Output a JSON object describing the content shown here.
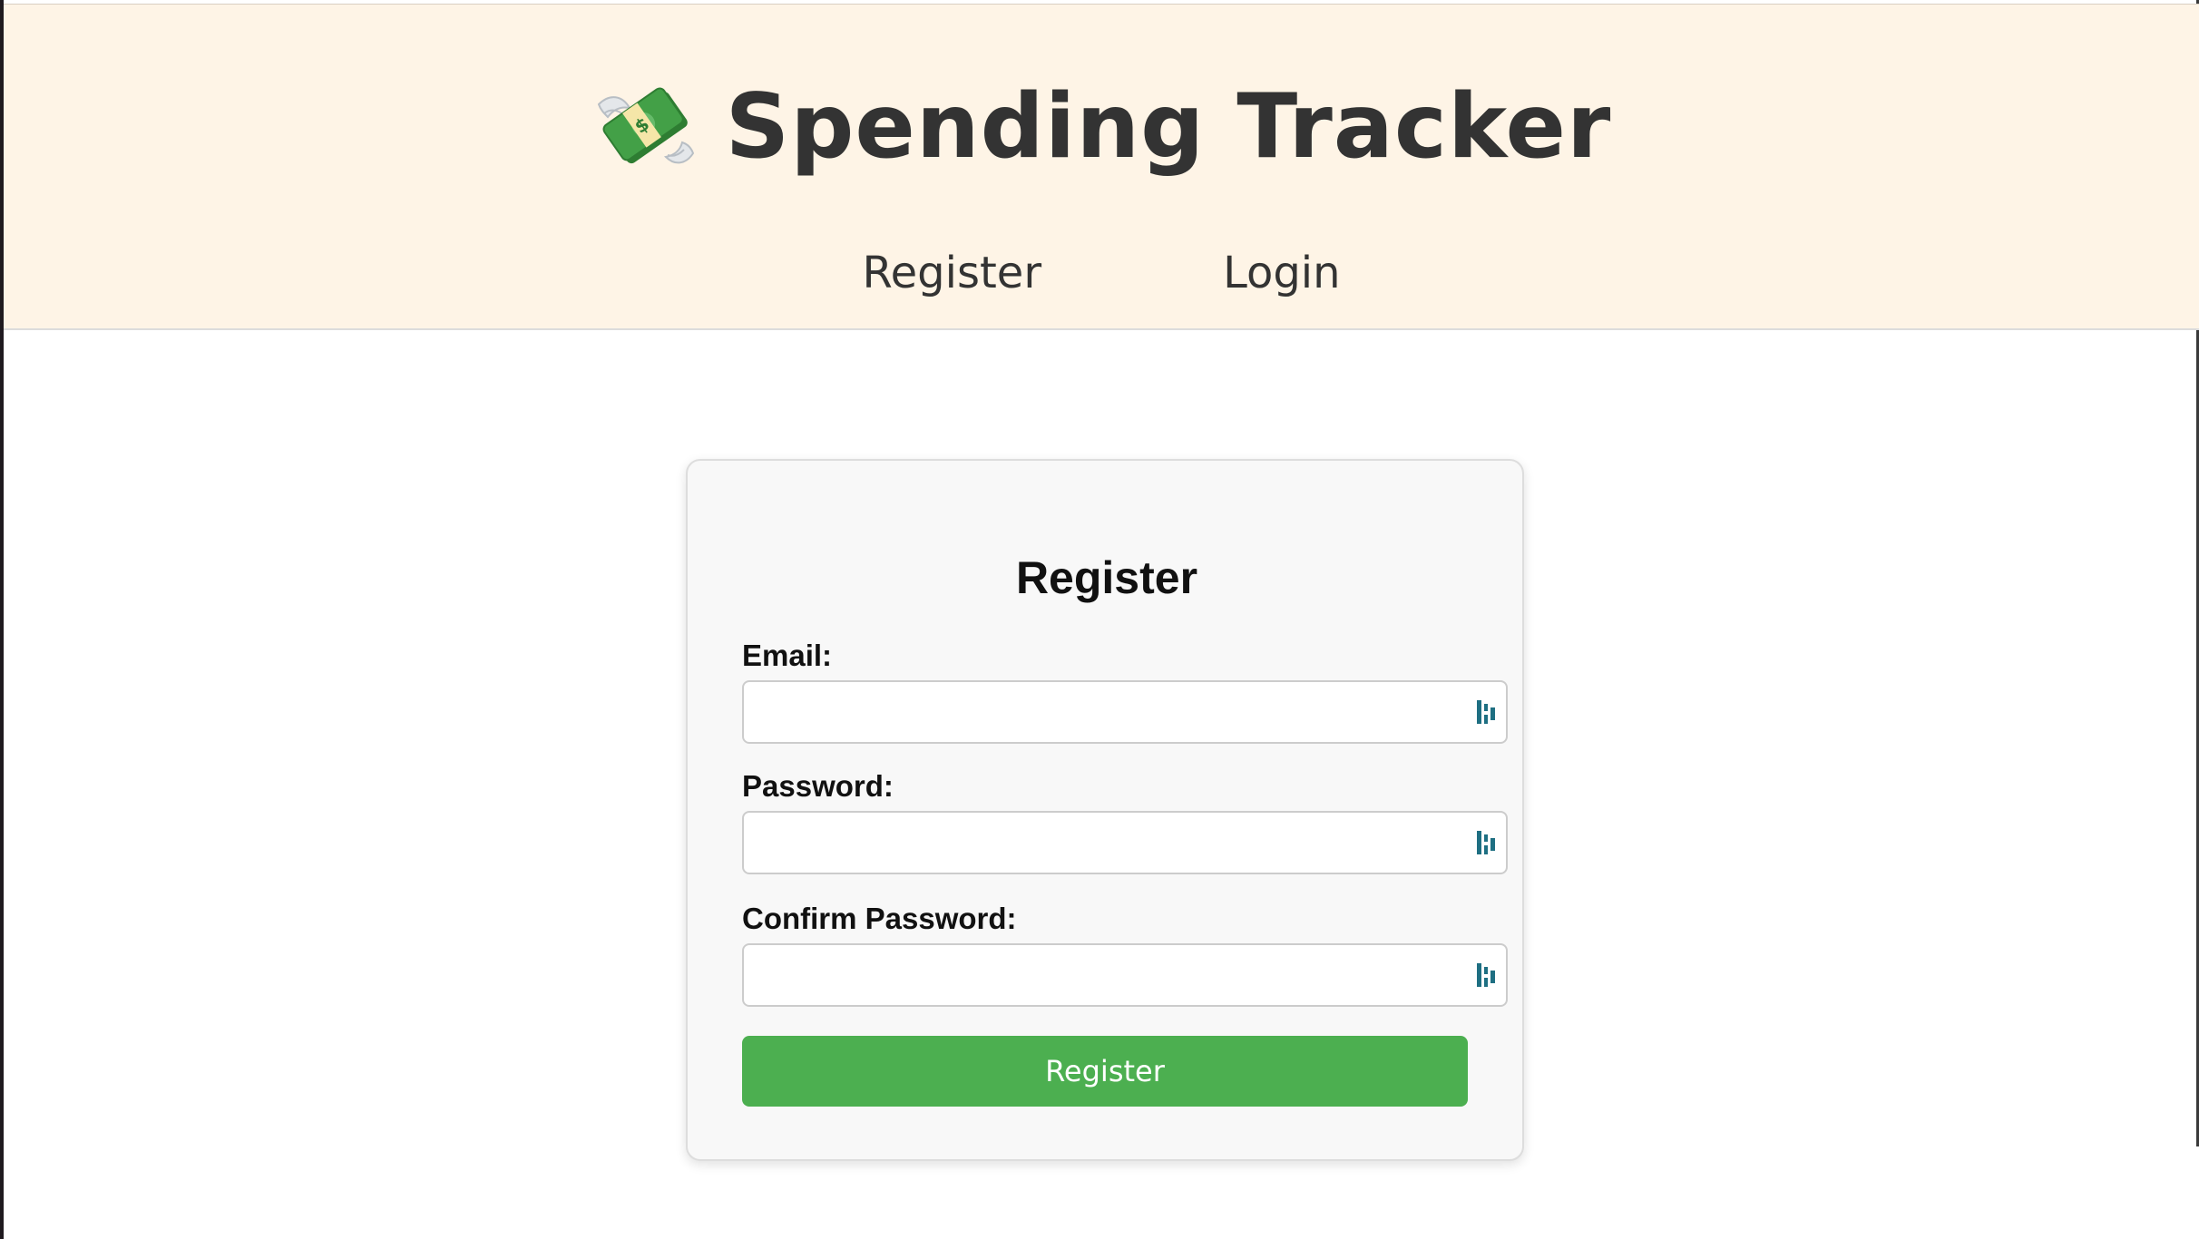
{
  "header": {
    "app_title": "Spending Tracker",
    "logo_icon": "money-with-wings-icon",
    "nav": {
      "register_label": "Register",
      "login_label": "Login"
    }
  },
  "form": {
    "title": "Register",
    "email_label": "Email:",
    "email_value": "",
    "password_label": "Password:",
    "password_value": "",
    "confirm_password_label": "Confirm Password:",
    "confirm_password_value": "",
    "field_icon": "password-manager-icon",
    "submit_label": "Register"
  },
  "colors": {
    "header_bg": "#fef4e6",
    "button_bg": "#4caf50",
    "button_text": "#ffffff",
    "card_bg": "#f8f8f8",
    "field_icon": "#1e6f82"
  }
}
